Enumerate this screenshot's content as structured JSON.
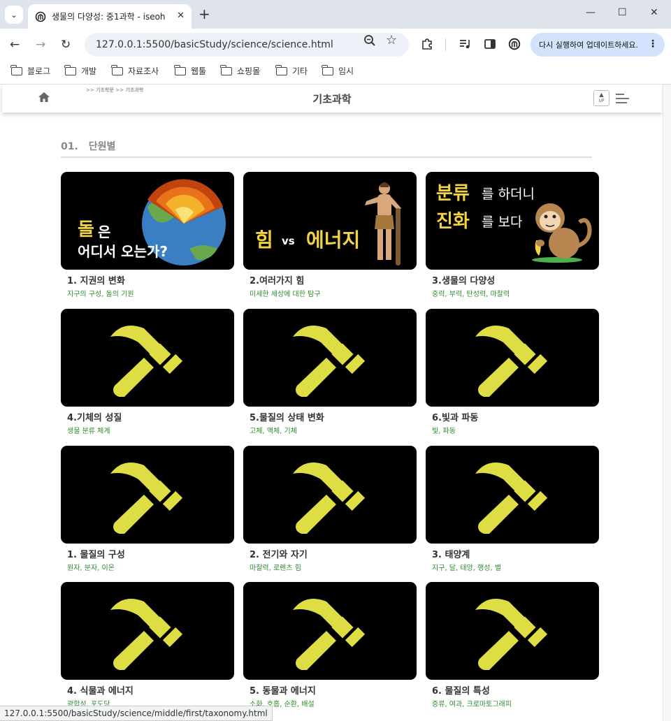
{
  "browser": {
    "tab_title": "생물의 다양성: 중1과학 - iseoh",
    "url": "127.0.0.1:5500/basicStudy/science/science.html",
    "update_button": "다시 실행하여 업데이트하세요.",
    "status_url": "127.0.0.1:5500/basicStudy/science/middle/first/taxonomy.html",
    "bookmarks": [
      "블로그",
      "개발",
      "자료조사",
      "웹툴",
      "쇼핑몰",
      "기타",
      "임시"
    ]
  },
  "site": {
    "breadcrumb": ">> 기초학문 >> 기초과학",
    "title": "기초과학",
    "up_label": "UP"
  },
  "section": {
    "number": "01.",
    "title": "단원별"
  },
  "thumbs": {
    "t1_big": "돌",
    "t1_small": "은",
    "t1_line2": "어디서 오는가?",
    "t2_force": "힘",
    "t2_vs": "vs",
    "t2_energy": "에너지",
    "t3_y1": "분류",
    "t3_w1": "를 하더니",
    "t3_y2": "진화",
    "t3_w2": "를 보다"
  },
  "cards": [
    {
      "title": "1. 지권의 변화",
      "subtitle": "지구의 구성, 돌의 기원"
    },
    {
      "title": "2.여러가지 힘",
      "subtitle": "미세한 세상에 대한 탐구"
    },
    {
      "title": "3.생물의 다양성",
      "subtitle": "중력, 부력, 탄성력, 마찰력"
    },
    {
      "title": "4.기체의 성질",
      "subtitle": "생물 분류 체계"
    },
    {
      "title": "5.물질의 상태 변화",
      "subtitle": "고체, 액체, 기체"
    },
    {
      "title": "6.빛과 파동",
      "subtitle": "빛, 파동"
    },
    {
      "title": "1. 물질의 구성",
      "subtitle": "원자, 분자, 이온"
    },
    {
      "title": "2. 전기와 자기",
      "subtitle": "마찰력, 로렌츠 힘"
    },
    {
      "title": "3. 태양계",
      "subtitle": "지구, 달, 태양, 행성, 별"
    },
    {
      "title": "4. 식물과 에너지",
      "subtitle": "광합성, 포도당"
    },
    {
      "title": "5. 동물과 에너지",
      "subtitle": "소화, 호흡, 순환, 배설"
    },
    {
      "title": "6. 물질의 특성",
      "subtitle": "증류, 여과, 크로마토그래피"
    }
  ],
  "colors": {
    "accent_yellow": "#f2d341",
    "hammer": "#dede44",
    "subtitle_green": "#2e8b2e"
  }
}
